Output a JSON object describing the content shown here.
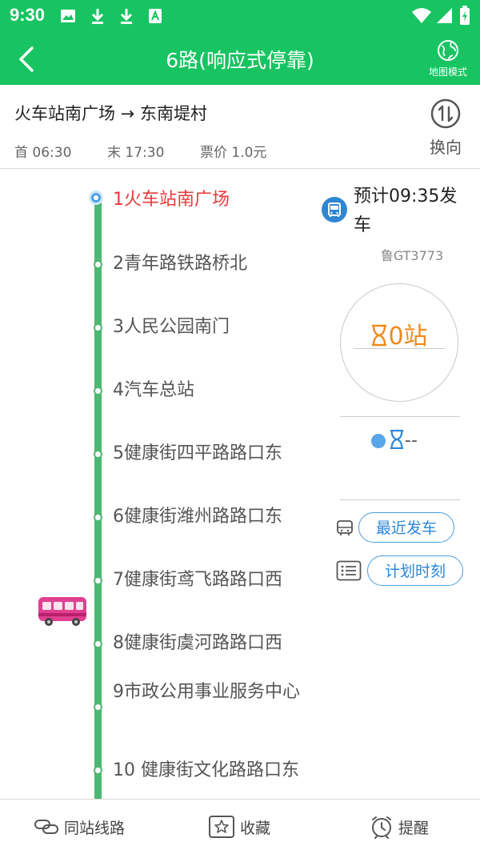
{
  "status_bar": {
    "time": "9:30"
  },
  "app_bar": {
    "title": "6路(响应式停靠)",
    "map_mode_label": "地图模式"
  },
  "route": {
    "direction": "火车站南广场 → 东南堤村",
    "first_bus": "首 06:30",
    "last_bus": "末 17:30",
    "fare": "票价 1.0元",
    "switch_label": "换向"
  },
  "stations": [
    {
      "name": "1火车站南广场"
    },
    {
      "name": "2青年路铁路桥北"
    },
    {
      "name": "3人民公园南门"
    },
    {
      "name": "4汽车总站"
    },
    {
      "name": "5健康街四平路路口东"
    },
    {
      "name": "6健康街潍州路路口东"
    },
    {
      "name": "7健康街鸢飞路路口西"
    },
    {
      "name": "8健康街虞河路路口西"
    },
    {
      "name": "9市政公用事业服务中心"
    },
    {
      "name": "10 健康街文化路路口东"
    }
  ],
  "arrival": {
    "departure_text": "预计09:35发车",
    "plate": "鲁GT3773",
    "stops_away": "0站",
    "next_bus": "--"
  },
  "buttons": {
    "recent_departure": "最近发车",
    "schedule": "计划时刻"
  },
  "bottom_bar": {
    "same_station": "同站线路",
    "favorite": "收藏",
    "reminder": "提醒"
  },
  "colors": {
    "primary_green": "#17c461",
    "line_green": "#4cb871",
    "accent_blue": "#2c86d6",
    "current_red": "#e83a3a",
    "stops_orange": "#f08a1c",
    "bus_pink": "#e0408f"
  },
  "icons": [
    "back-arrow-icon",
    "globe-icon",
    "swap-icon",
    "bus-icon",
    "hourglass-icon",
    "list-icon",
    "link-icon",
    "star-icon",
    "alarm-clock-icon"
  ]
}
